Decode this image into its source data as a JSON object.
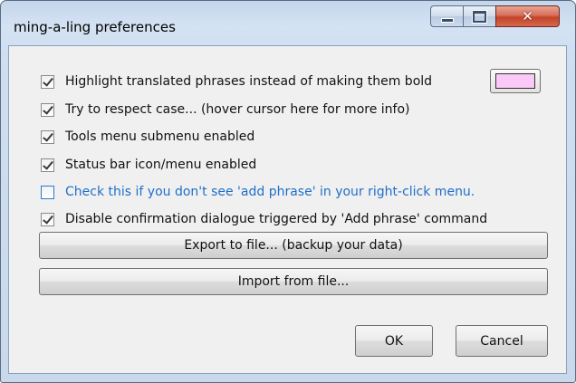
{
  "window": {
    "title": "ming-a-ling preferences",
    "caption_buttons": {
      "minimize_icon": "minimize-icon",
      "maximize_icon": "maximize-icon",
      "close_icon": "close-icon",
      "close_glyph": "✕"
    }
  },
  "options": [
    {
      "label": "Highlight translated phrases instead of making them bold",
      "checked": true
    },
    {
      "label": "Try to respect case... (hover cursor here for more info)",
      "checked": true
    },
    {
      "label": "Tools menu submenu enabled",
      "checked": true
    },
    {
      "label": "Status bar icon/menu enabled",
      "checked": true
    },
    {
      "label": "Check this if you don't see 'add phrase' in your right-click menu.",
      "checked": false
    },
    {
      "label": "Disable confirmation dialogue triggered by 'Add phrase' command",
      "checked": true
    }
  ],
  "highlight_color": "#fbc9f7",
  "buttons": {
    "export_label": "Export to file... (backup your data)",
    "import_label": "Import from file...",
    "ok_label": "OK",
    "cancel_label": "Cancel"
  },
  "colors": {
    "link_text": "#1f6fc9",
    "close_button": "#c4432a"
  }
}
